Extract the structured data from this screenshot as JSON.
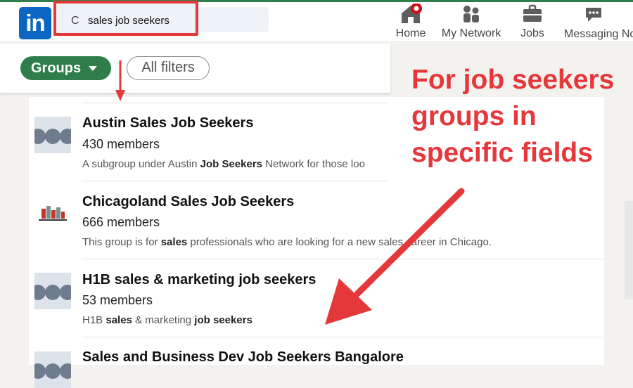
{
  "search": {
    "query": "sales job seekers"
  },
  "nav": {
    "items": [
      {
        "label": "Home",
        "icon": "home-icon"
      },
      {
        "label": "My Network",
        "icon": "network-icon"
      },
      {
        "label": "Jobs",
        "icon": "briefcase-icon"
      },
      {
        "label": "Messaging No",
        "icon": "messaging-icon"
      }
    ]
  },
  "filters": {
    "groups_label": "Groups",
    "all_filters_label": "All filters"
  },
  "results": [
    {
      "name": "Austin Sales Job Seekers",
      "members": "430 members",
      "desc_parts": [
        "A subgroup under Austin ",
        "Job Seekers",
        " Network for those loo"
      ]
    },
    {
      "name": "Chicagoland Sales Job Seekers",
      "members": "666 members",
      "desc_parts": [
        "This group is for ",
        "sales",
        " professionals who are looking for a new sales career in Chicago."
      ]
    },
    {
      "name": "H1B sales & marketing job seekers",
      "members": "53 members",
      "desc_parts": [
        "H1B ",
        "sales",
        " & marketing ",
        "job seekers"
      ]
    },
    {
      "name": "Sales and Business Dev Job Seekers Bangalore"
    }
  ],
  "annotation": {
    "line1": "For job seekers",
    "line2": "groups in",
    "line3": "specific fields"
  },
  "colors": {
    "accent_red": "#e5383b",
    "linkedin_blue": "#0a66c2",
    "groups_green": "#2e7d4a"
  }
}
